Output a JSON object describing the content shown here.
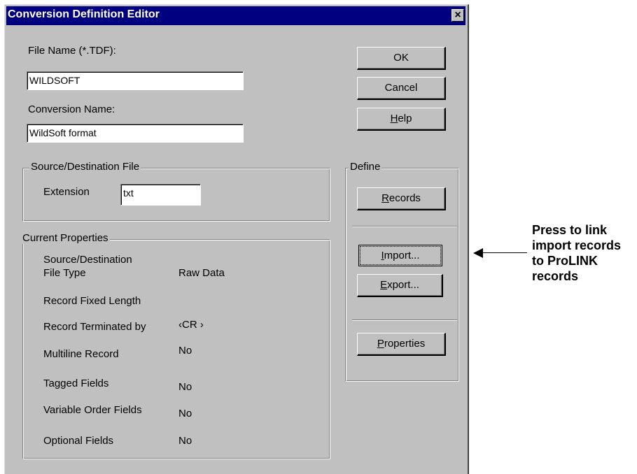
{
  "window": {
    "title": "Conversion Definition Editor",
    "close_glyph": "×"
  },
  "fields": {
    "file_name_label": "File Name (*.TDF):",
    "file_name_value": "WILDSOFT",
    "conversion_name_label": "Conversion Name:",
    "conversion_name_value": "WildSoft format"
  },
  "buttons": {
    "ok": "OK",
    "cancel": "Cancel",
    "help_prefix": "",
    "help_accel": "H",
    "help_rest": "elp"
  },
  "source_dest": {
    "title": "Source/Destination File",
    "extension_label": "Extension",
    "extension_value": "txt"
  },
  "define": {
    "title": "Define",
    "records_accel": "R",
    "records_rest": "ecords",
    "import_accel": "I",
    "import_rest": "mport...",
    "export_accel": "E",
    "export_rest": "xport...",
    "properties_accel": "P",
    "properties_rest": "roperties"
  },
  "current_properties": {
    "title": "Current Properties",
    "rows": [
      {
        "label_line1": "Source/Destination",
        "label_line2": "File Type",
        "value": "Raw Data"
      },
      {
        "label": "Record Fixed Length",
        "value": ""
      },
      {
        "label": "Record Terminated by",
        "value": "‹CR  ›"
      },
      {
        "label": "Multiline Record",
        "value": "No"
      },
      {
        "label": "Tagged Fields",
        "value": "No"
      },
      {
        "label": "Variable Order Fields",
        "value": "No"
      },
      {
        "label": "Optional Fields",
        "value": "No"
      }
    ]
  },
  "annotation": {
    "lines": [
      "Press to link",
      "import records",
      "to ProLINK",
      "records"
    ],
    "arrow_icon": "left-arrow-icon"
  },
  "colors": {
    "titlebar": "#000080",
    "dialog_face": "#c0c0c0",
    "input_bg": "#ffffff"
  }
}
